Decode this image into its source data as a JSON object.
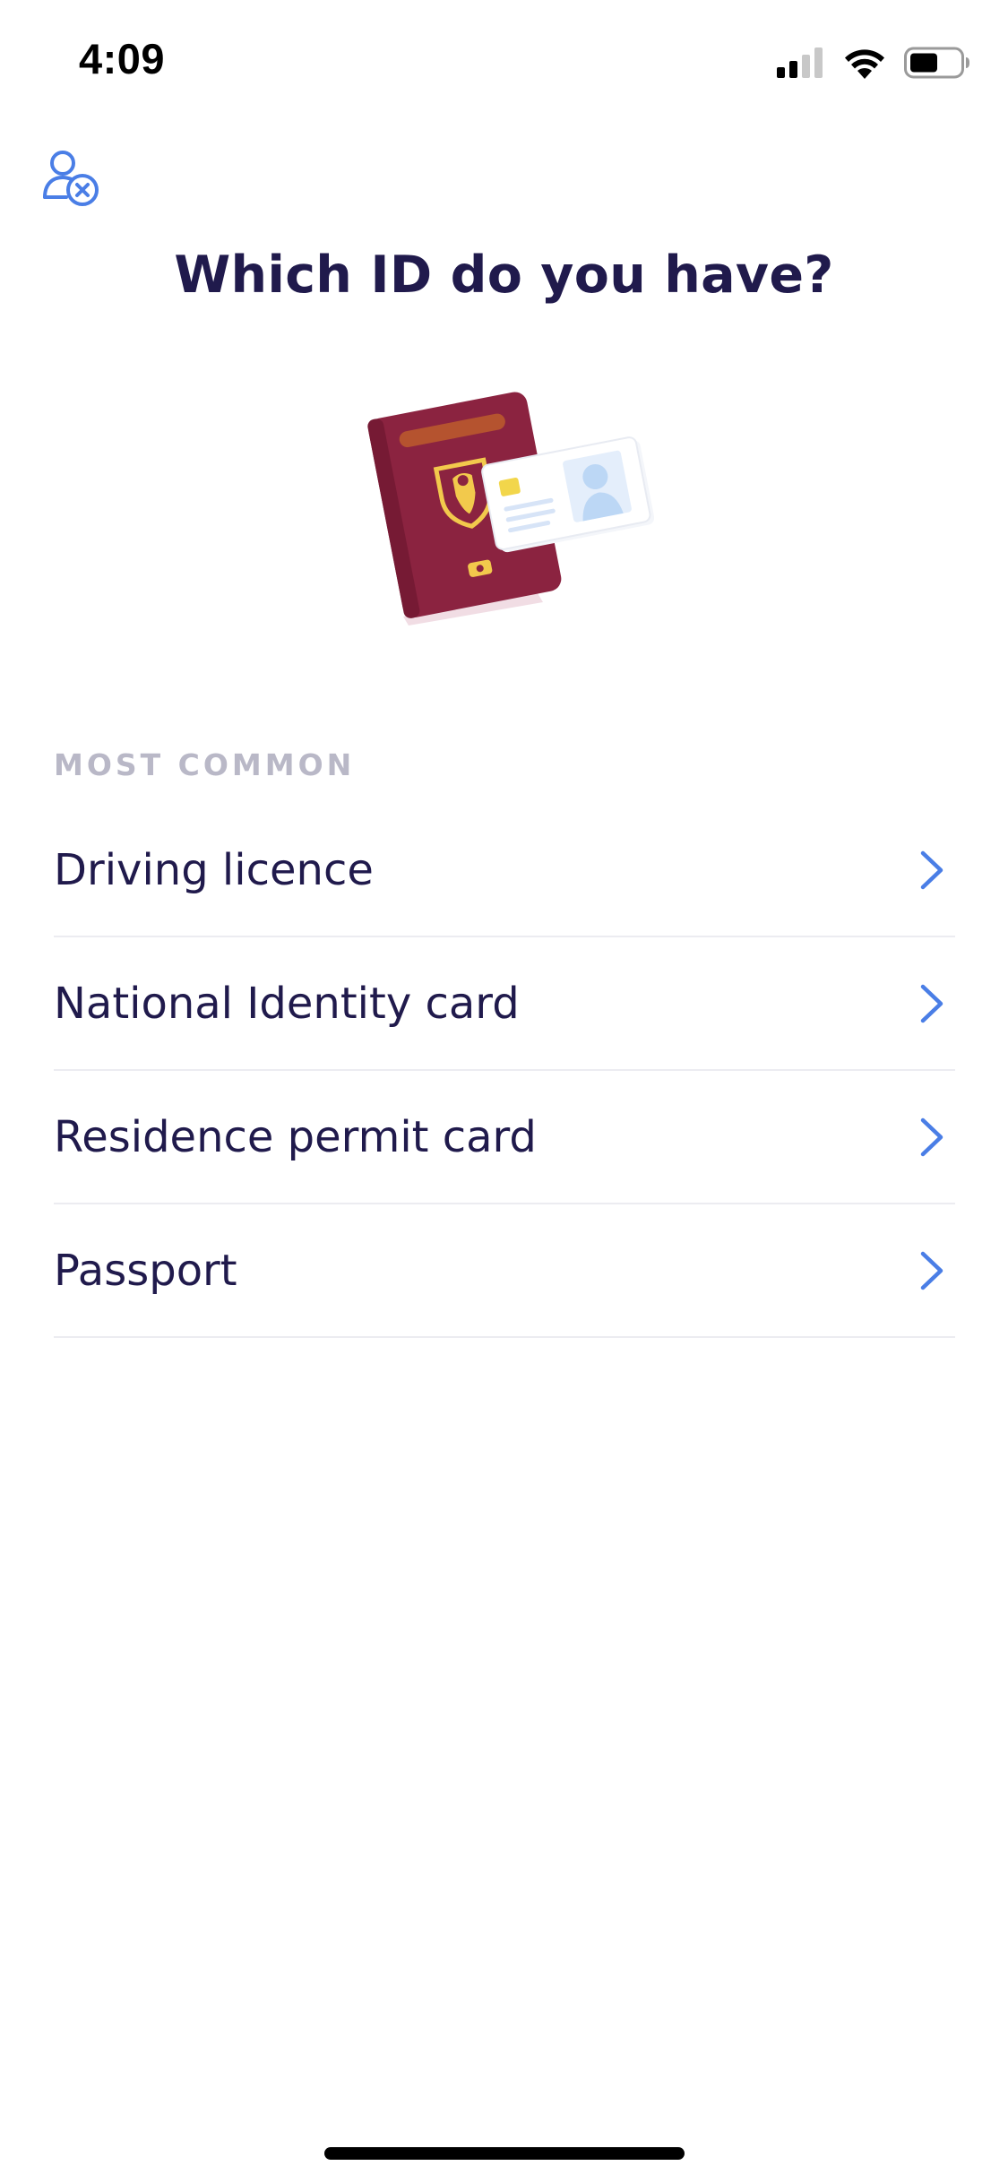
{
  "status_bar": {
    "time": "4:09",
    "icons": [
      "cellular-signal-icon",
      "wifi-icon",
      "battery-icon"
    ]
  },
  "header": {
    "profile_icon": "user-remove-icon",
    "title": "Which ID do you have?"
  },
  "illustration": {
    "name": "passport-and-id-card-illustration",
    "colors": {
      "passport": "#8b2340",
      "passport_band": "#b5532f",
      "emblem": "#f2c94c",
      "card": "#ffffff",
      "card_photo": "#bcd7f5"
    }
  },
  "section": {
    "header": "MOST COMMON",
    "items": [
      {
        "label": "Driving licence"
      },
      {
        "label": "National Identity card"
      },
      {
        "label": "Residence permit card"
      },
      {
        "label": "Passport"
      }
    ]
  },
  "colors": {
    "title": "#201a4c",
    "accent": "#4a7ee6",
    "divider": "#ececf1",
    "section_header": "#b9b8c7"
  }
}
